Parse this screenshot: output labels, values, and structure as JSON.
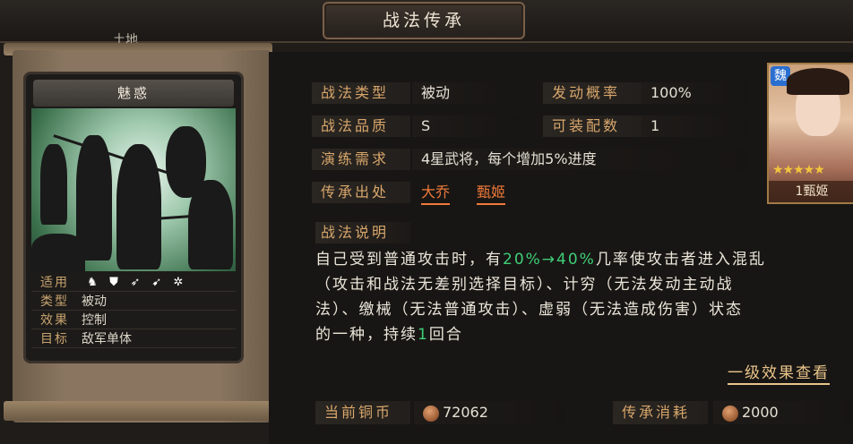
{
  "header": {
    "title": "战法传承",
    "terrain": "土地"
  },
  "card": {
    "name": "魅惑",
    "stats": [
      {
        "label": "适用",
        "value": ""
      },
      {
        "label": "类型",
        "value": "被动"
      },
      {
        "label": "效果",
        "value": "控制"
      },
      {
        "label": "目标",
        "value": "敌军单体"
      }
    ],
    "unit_icons": [
      "cavalry-icon",
      "shield-icon",
      "bow-icon",
      "spear-icon",
      "siege-icon"
    ]
  },
  "fields": {
    "type_label": "战法类型",
    "type_value": "被动",
    "prob_label": "发动概率",
    "prob_value": "100%",
    "quality_label": "战法品质",
    "quality_value": "S",
    "equip_label": "可装配数",
    "equip_value": "1",
    "req_label": "演练需求",
    "req_value": "4星武将，每个增加5%进度",
    "source_label": "传承出处",
    "source_1": "大乔",
    "source_2": "甄姬"
  },
  "description": {
    "label": "战法说明",
    "line1_a": "自己受到普通攻击时，有",
    "line1_g": "20%→40%",
    "line1_b": "几率使攻击者进入混乱",
    "line2": "（攻击和战法无差别选择目标）、计穷（无法发动主动战",
    "line3": "法）、缴械（无法普通攻击）、虚弱（无法造成伤害）状态",
    "line4_a": "的一种，持续",
    "line4_g": "1",
    "line4_b": "回合",
    "level_link": "一级效果查看"
  },
  "portrait": {
    "faction": "魏",
    "stars": "★★★★★",
    "name": "1甄姬"
  },
  "footer": {
    "coins_label": "当前铜币",
    "coins_value": "72062",
    "cost_label": "传承消耗",
    "cost_value": "2000"
  },
  "colors": {
    "accent": "#d8a66b",
    "highlight": "#3ecf77",
    "source": "#f07a3a"
  }
}
